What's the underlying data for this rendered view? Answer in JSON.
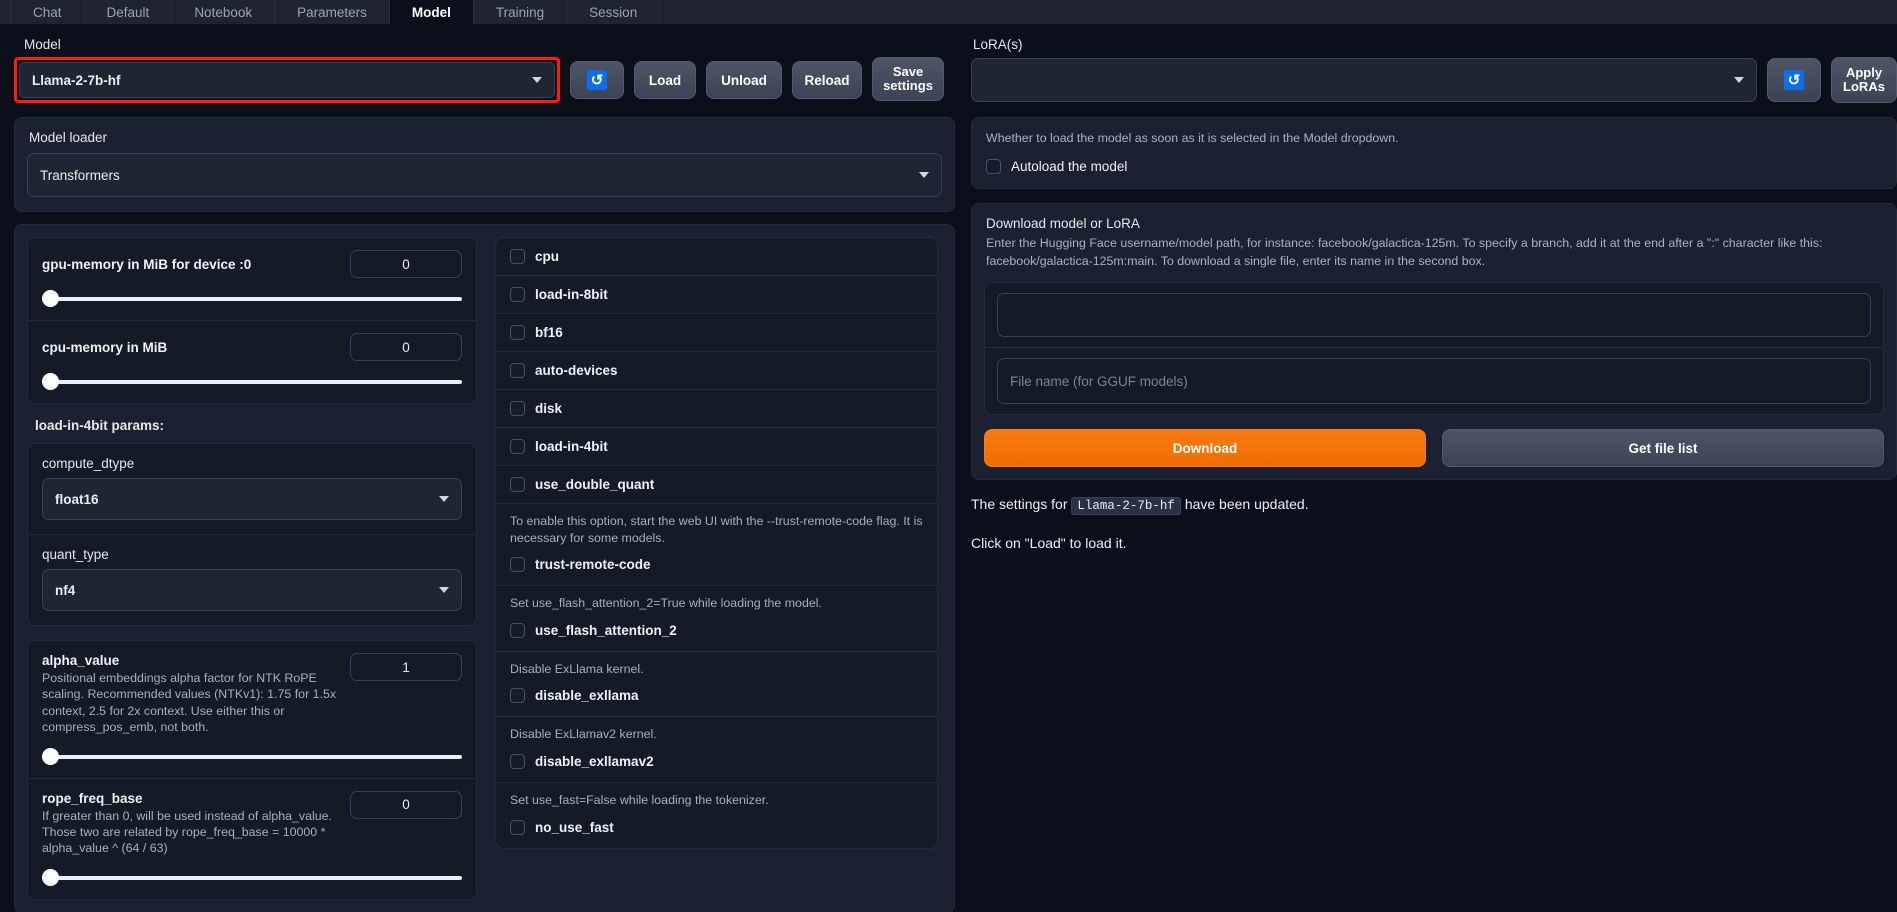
{
  "tabs": [
    {
      "label": "Chat",
      "active": false
    },
    {
      "label": "Default",
      "active": false
    },
    {
      "label": "Notebook",
      "active": false
    },
    {
      "label": "Parameters",
      "active": false
    },
    {
      "label": "Model",
      "active": true
    },
    {
      "label": "Training",
      "active": false
    },
    {
      "label": "Session",
      "active": false
    }
  ],
  "model": {
    "label": "Model",
    "value": "Llama-2-7b-hf",
    "refresh_icon": "refresh-icon",
    "buttons": {
      "load": "Load",
      "unload": "Unload",
      "reload": "Reload",
      "save_settings_line1": "Save",
      "save_settings_line2": "settings"
    },
    "highlight_color": "#ff1a1a"
  },
  "model_loader": {
    "label": "Model loader",
    "value": "Transformers"
  },
  "sliders": [
    {
      "name": "gpu-memory in MiB for device :0",
      "value": "0",
      "desc": "",
      "knob_pct": 0
    },
    {
      "name": "cpu-memory in MiB",
      "value": "0",
      "desc": "",
      "knob_pct": 0
    }
  ],
  "load_in_4bit_params": {
    "title": "load-in-4bit params:",
    "compute_dtype": {
      "label": "compute_dtype",
      "value": "float16"
    },
    "quant_type": {
      "label": "quant_type",
      "value": "nf4"
    }
  },
  "rope_sliders": [
    {
      "name": "alpha_value",
      "value": "1",
      "desc": "Positional embeddings alpha factor for NTK RoPE scaling. Recommended values (NTKv1): 1.75 for 1.5x context, 2.5 for 2x context. Use either this or compress_pos_emb, not both.",
      "knob_pct": 0
    },
    {
      "name": "rope_freq_base",
      "value": "0",
      "desc": "If greater than 0, will be used instead of alpha_value. Those two are related by rope_freq_base = 10000 * alpha_value ^ (64 / 63)",
      "knob_pct": 0
    }
  ],
  "checkboxes": [
    {
      "label": "cpu",
      "checked": false,
      "help": ""
    },
    {
      "label": "load-in-8bit",
      "checked": false,
      "help": ""
    },
    {
      "label": "bf16",
      "checked": false,
      "help": ""
    },
    {
      "label": "auto-devices",
      "checked": false,
      "help": ""
    },
    {
      "label": "disk",
      "checked": false,
      "help": ""
    },
    {
      "label": "load-in-4bit",
      "checked": false,
      "help": ""
    },
    {
      "label": "use_double_quant",
      "checked": false,
      "help": ""
    },
    {
      "label": "trust-remote-code",
      "checked": false,
      "help": "To enable this option, start the web UI with the --trust-remote-code flag. It is necessary for some models."
    },
    {
      "label": "use_flash_attention_2",
      "checked": false,
      "help": "Set use_flash_attention_2=True while loading the model."
    },
    {
      "label": "disable_exllama",
      "checked": false,
      "help": "Disable ExLlama kernel."
    },
    {
      "label": "disable_exllamav2",
      "checked": false,
      "help": "Disable ExLlamav2 kernel."
    },
    {
      "label": "no_use_fast",
      "checked": false,
      "help": "Set use_fast=False while loading the tokenizer."
    }
  ],
  "lora": {
    "label": "LoRA(s)",
    "value": "",
    "refresh_icon": "refresh-icon",
    "apply_line1": "Apply",
    "apply_line2": "LoRAs"
  },
  "autoload": {
    "help": "Whether to load the model as soon as it is selected in the Model dropdown.",
    "label": "Autoload the model",
    "checked": false
  },
  "download": {
    "title": "Download model or LoRA",
    "description": "Enter the Hugging Face username/model path, for instance: facebook/galactica-125m. To specify a branch, add it at the end after a \":\" character like this: facebook/galactica-125m:main. To download a single file, enter its name in the second box.",
    "repo_value": "",
    "repo_placeholder": "",
    "file_value": "",
    "file_placeholder": "File name (for GGUF models)",
    "download_button": "Download",
    "getfilelist_button": "Get file list",
    "download_color": "#f97b16"
  },
  "status": {
    "line1_prefix": "The settings for",
    "line1_code": "Llama-2-7b-hf",
    "line1_suffix": "have been updated.",
    "line2": "Click on \"Load\" to load it."
  }
}
